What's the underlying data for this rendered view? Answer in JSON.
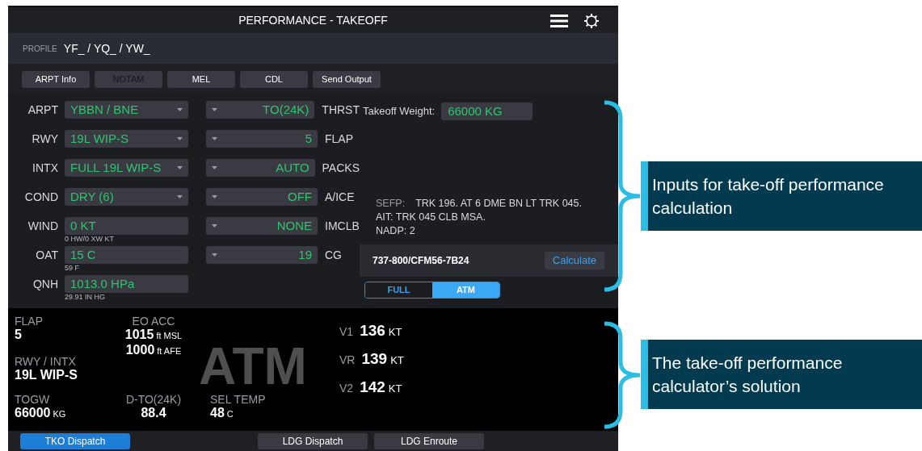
{
  "window": {
    "title": "PERFORMANCE - TAKEOFF"
  },
  "profile": {
    "label": "PROFILE",
    "value": "YF_ / YQ_ / YW_"
  },
  "toolbar": [
    {
      "label": "ARPT Info",
      "disabled": false
    },
    {
      "label": "NOTAM",
      "disabled": true
    },
    {
      "label": "MEL",
      "disabled": false
    },
    {
      "label": "CDL",
      "disabled": false
    },
    {
      "label": "Send Output",
      "disabled": false
    }
  ],
  "left_fields": [
    {
      "label": "ARPT",
      "value": "YBBN / BNE",
      "kind": "dropdown"
    },
    {
      "label": "RWY",
      "value": "19L WIP-S",
      "kind": "dropdown"
    },
    {
      "label": "INTX",
      "value": "FULL 19L WIP-S",
      "kind": "dropdown"
    },
    {
      "label": "COND",
      "value": "DRY (6)",
      "kind": "dropdown"
    },
    {
      "label": "WIND",
      "value": "0 KT",
      "kind": "input",
      "hint": "0 HW/0 XW KT"
    },
    {
      "label": "OAT",
      "value": "15 C",
      "kind": "input",
      "hint": "59 F"
    },
    {
      "label": "QNH",
      "value": "1013.0 HPa",
      "kind": "input",
      "hint": "29.91 IN HG"
    }
  ],
  "right_fields": [
    {
      "label": "THRST",
      "value": "TO(24K)"
    },
    {
      "label": "FLAP",
      "value": "5"
    },
    {
      "label": "PACKS",
      "value": "AUTO"
    },
    {
      "label": "A/ICE",
      "value": "OFF"
    },
    {
      "label": "IMCLB",
      "value": "NONE"
    },
    {
      "label": "CG",
      "value": "19"
    }
  ],
  "takeoff_weight": {
    "label": "Takeoff Weight:",
    "value": "66000 KG"
  },
  "procedure": {
    "label": "SEFP:",
    "lines": [
      "TRK 196. AT 6 DME BN LT TRK 045.",
      "AIT: TRK 045 CLB MSA.",
      "NADP: 2"
    ]
  },
  "aircraft": "737-800/CFM56-7B24",
  "calculate_button": "Calculate",
  "mode_toggle": [
    {
      "label": "FULL",
      "selected": false
    },
    {
      "label": "ATM",
      "selected": true
    }
  ],
  "results": {
    "flap": {
      "label": "FLAP",
      "value": "5"
    },
    "eo_acc": {
      "label": "EO ACC",
      "lines": [
        {
          "value": "1015",
          "unit": "ft MSL"
        },
        {
          "value": "1000",
          "unit": "ft AFE"
        }
      ]
    },
    "rwy_intx": {
      "label": "RWY / INTX",
      "value": "19L WIP-S"
    },
    "togw": {
      "label": "TOGW",
      "value": "66000",
      "unit": "KG"
    },
    "d_to": {
      "label": "D-TO(24K)",
      "value": "88.4"
    },
    "sel_temp": {
      "label": "SEL TEMP",
      "value": "48",
      "unit": "C"
    },
    "watermark": "ATM",
    "speeds": [
      {
        "label": "V1",
        "value": "136",
        "unit": "KT"
      },
      {
        "label": "VR",
        "value": "139",
        "unit": "KT"
      },
      {
        "label": "V2",
        "value": "142",
        "unit": "KT"
      }
    ]
  },
  "bottom_tabs": [
    {
      "label": "TKO Dispatch",
      "selected": true
    },
    {
      "label": "LDG Dispatch",
      "selected": false
    },
    {
      "label": "LDG Enroute",
      "selected": false
    }
  ],
  "annotations": [
    {
      "text": "Inputs for take-off performance calculation"
    },
    {
      "text": "The take-off performance calculator’s solution"
    }
  ]
}
